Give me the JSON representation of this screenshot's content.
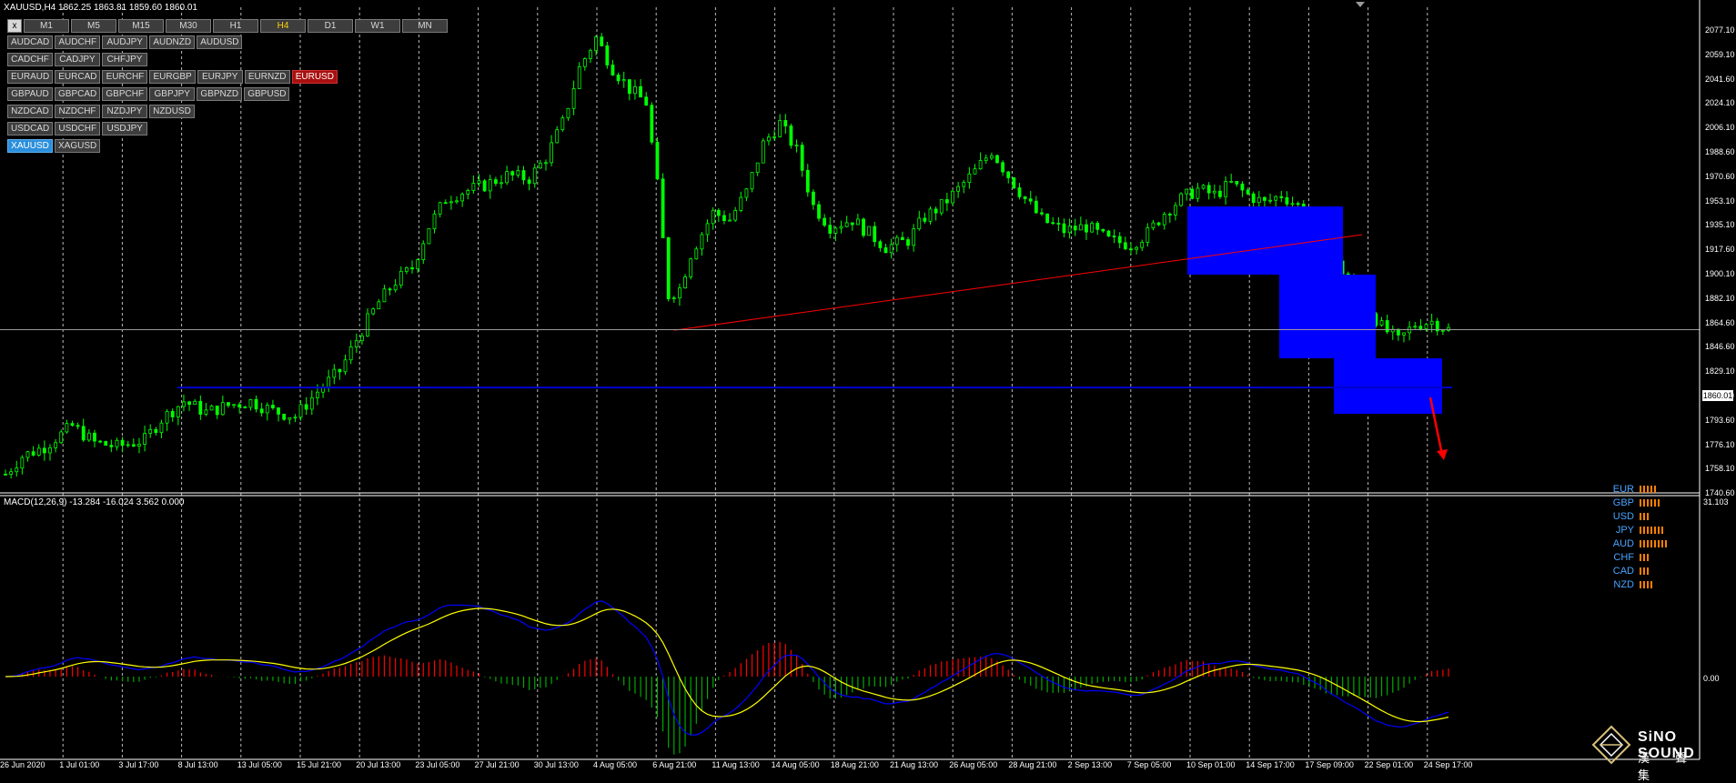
{
  "header": {
    "title": "XAUUSD,H4  1862.25 1863.81 1859.60 1860.01",
    "close_button": "x"
  },
  "timeframes": [
    {
      "label": "M1",
      "active": false
    },
    {
      "label": "M5",
      "active": false
    },
    {
      "label": "M15",
      "active": false
    },
    {
      "label": "M30",
      "active": false
    },
    {
      "label": "H1",
      "active": false
    },
    {
      "label": "H4",
      "active": true
    },
    {
      "label": "D1",
      "active": false
    },
    {
      "label": "W1",
      "active": false
    },
    {
      "label": "MN",
      "active": false
    }
  ],
  "symbols": [
    [
      "AUDCAD",
      "AUDCHF",
      "AUDJPY",
      "AUDNZD",
      "AUDUSD"
    ],
    [
      "CADCHF",
      "CADJPY",
      "CHFJPY"
    ],
    [
      "EURAUD",
      "EURCAD",
      "EURCHF",
      "EURGBP",
      "EURJPY",
      "EURNZD",
      "EURUSD"
    ],
    [
      "GBPAUD",
      "GBPCAD",
      "GBPCHF",
      "GBPJPY",
      "GBPNZD",
      "GBPUSD"
    ],
    [
      "NZDCAD",
      "NZDCHF",
      "NZDJPY",
      "NZDUSD"
    ],
    [
      "USDCAD",
      "USDCHF",
      "USDJPY"
    ],
    [
      "XAUUSD",
      "XAGUSD"
    ]
  ],
  "highlighted_symbols": {
    "red": "EURUSD",
    "blue": "XAUUSD"
  },
  "price_axis": [
    "2077.10",
    "2059.10",
    "2041.60",
    "2024.10",
    "2006.10",
    "1988.60",
    "1970.60",
    "1953.10",
    "1935.10",
    "1917.60",
    "1900.10",
    "1882.10",
    "1864.60",
    "1846.60",
    "1829.10",
    "1811.10",
    "1793.60",
    "1776.10",
    "1758.10",
    "1740.60"
  ],
  "current_price": "1860.01",
  "macd": {
    "label": "MACD(12,26,9) -13.284 -16.024 3.562 0.000",
    "axis_top": "31.103",
    "axis_zero": "0.00"
  },
  "date_axis": [
    "26 Jun 2020",
    "1 Jul 01:00",
    "3 Jul 17:00",
    "8 Jul 13:00",
    "13 Jul 05:00",
    "15 Jul 21:00",
    "20 Jul 13:00",
    "23 Jul 05:00",
    "27 Jul 21:00",
    "30 Jul 13:00",
    "4 Aug 05:00",
    "6 Aug 21:00",
    "11 Aug 13:00",
    "14 Aug 05:00",
    "18 Aug 21:00",
    "21 Aug 13:00",
    "26 Aug 05:00",
    "28 Aug 21:00",
    "2 Sep 13:00",
    "7 Sep 05:00",
    "10 Sep 01:00",
    "14 Sep 17:00",
    "17 Sep 09:00",
    "22 Sep 01:00",
    "24 Sep 17:00"
  ],
  "currency_strength": [
    {
      "name": "EUR",
      "bars": 5
    },
    {
      "name": "GBP",
      "bars": 6
    },
    {
      "name": "USD",
      "bars": 3
    },
    {
      "name": "JPY",
      "bars": 7
    },
    {
      "name": "AUD",
      "bars": 8
    },
    {
      "name": "CHF",
      "bars": 3
    },
    {
      "name": "CAD",
      "bars": 3
    },
    {
      "name": "NZD",
      "bars": 4
    }
  ],
  "logo": {
    "name": "SiNO SOUND",
    "sub": "漢 聲 集"
  },
  "colors": {
    "candle": "#00ff00",
    "rectangle": "#0000ff",
    "trendline": "#ff0000",
    "support_line": "#0000cc",
    "macd_line": "#0000ff",
    "signal_line": "#ffff00",
    "hist_pos": "#ff0000",
    "hist_neg": "#00aa00",
    "strength_bar": "#ff7f00"
  },
  "chart_data": {
    "type": "candlestick",
    "symbol": "XAUUSD",
    "timeframe": "H4",
    "ylim": [
      1740.6,
      2077.1
    ],
    "last": {
      "open": 1862.25,
      "high": 1863.81,
      "low": 1859.6,
      "close": 1860.01
    },
    "price_path": [
      [
        0,
        1755
      ],
      [
        3,
        1768
      ],
      [
        7,
        1775
      ],
      [
        12,
        1790
      ],
      [
        16,
        1778
      ],
      [
        20,
        1775
      ],
      [
        25,
        1780
      ],
      [
        28,
        1795
      ],
      [
        32,
        1808
      ],
      [
        36,
        1800
      ],
      [
        40,
        1805
      ],
      [
        44,
        1808
      ],
      [
        48,
        1801
      ],
      [
        52,
        1797
      ],
      [
        56,
        1815
      ],
      [
        60,
        1830
      ],
      [
        64,
        1860
      ],
      [
        67,
        1880
      ],
      [
        70,
        1895
      ],
      [
        73,
        1905
      ],
      [
        76,
        1935
      ],
      [
        79,
        1955
      ],
      [
        82,
        1960
      ],
      [
        86,
        1965
      ],
      [
        90,
        1972
      ],
      [
        94,
        1970
      ],
      [
        97,
        1985
      ],
      [
        100,
        2010
      ],
      [
        103,
        2050
      ],
      [
        106,
        2072
      ],
      [
        109,
        2050
      ],
      [
        112,
        2035
      ],
      [
        115,
        2025
      ],
      [
        117,
        1965
      ],
      [
        119,
        1885
      ],
      [
        121,
        1890
      ],
      [
        123,
        1915
      ],
      [
        127,
        1945
      ],
      [
        130,
        1940
      ],
      [
        133,
        1960
      ],
      [
        136,
        1995
      ],
      [
        139,
        2010
      ],
      [
        142,
        1990
      ],
      [
        145,
        1950
      ],
      [
        148,
        1935
      ],
      [
        152,
        1940
      ],
      [
        155,
        1930
      ],
      [
        158,
        1920
      ],
      [
        162,
        1925
      ],
      [
        165,
        1942
      ],
      [
        168,
        1950
      ],
      [
        171,
        1962
      ],
      [
        174,
        1975
      ],
      [
        177,
        1990
      ],
      [
        180,
        1972
      ],
      [
        183,
        1955
      ],
      [
        186,
        1940
      ],
      [
        190,
        1932
      ],
      [
        194,
        1935
      ],
      [
        198,
        1925
      ],
      [
        202,
        1922
      ],
      [
        205,
        1930
      ],
      [
        208,
        1945
      ],
      [
        211,
        1955
      ],
      [
        214,
        1962
      ],
      [
        217,
        1958
      ],
      [
        220,
        1966
      ],
      [
        223,
        1958
      ],
      [
        226,
        1952
      ],
      [
        229,
        1958
      ],
      [
        232,
        1950
      ],
      [
        235,
        1928
      ],
      [
        238,
        1912
      ],
      [
        241,
        1898
      ],
      [
        244,
        1880
      ],
      [
        247,
        1862
      ],
      [
        250,
        1852
      ],
      [
        253,
        1864
      ],
      [
        256,
        1866
      ],
      [
        259,
        1860
      ]
    ],
    "trendline": [
      [
        1859.5,
        0.41
      ],
      [
        1929,
        0.78
      ]
    ],
    "support_level": 1818
  }
}
